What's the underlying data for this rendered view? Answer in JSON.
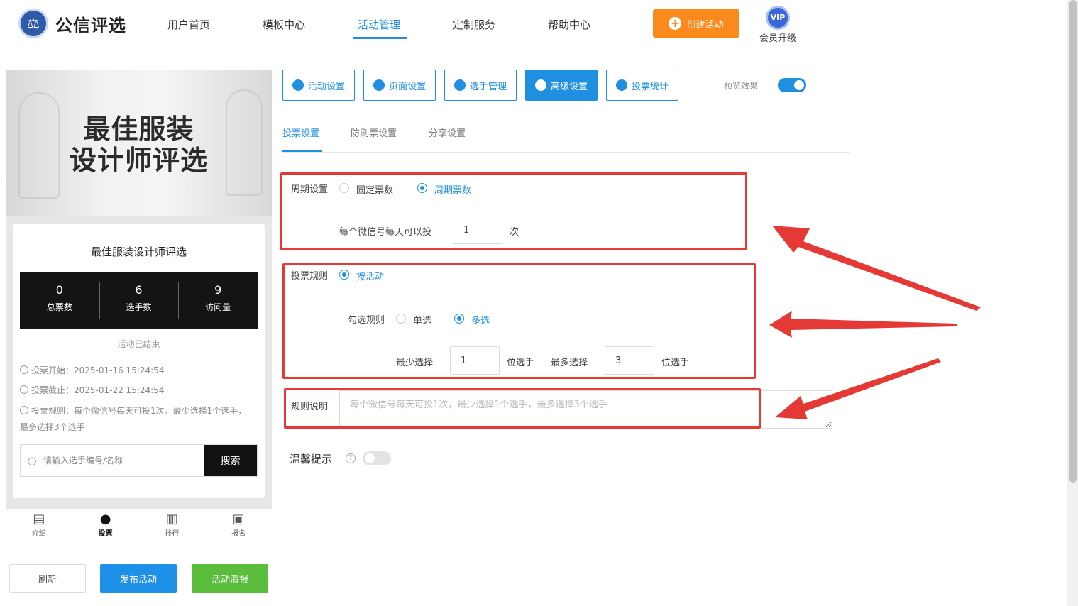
{
  "header": {
    "logo_text": "公信评选",
    "nav": [
      "用户首页",
      "模板中心",
      "活动管理",
      "定制服务",
      "帮助中心"
    ],
    "active_nav": "活动管理",
    "create_label": "创建活动",
    "vip_badge": "VIP",
    "vip_label": "会员升级"
  },
  "preview": {
    "banner_line1": "最佳服装",
    "banner_line2": "设计师评选",
    "activity_title": "最佳服装设计师评选",
    "stats": [
      {
        "value": "0",
        "label": "总票数"
      },
      {
        "value": "6",
        "label": "选手数"
      },
      {
        "value": "9",
        "label": "访问量"
      }
    ],
    "status": "活动已结束",
    "start": "投票开始：2025-01-16 15:24:54",
    "end": "投票截止：2025-01-22 15:24:54",
    "rule": "投票规则：每个微信号每天可投1次，最少选择1个选手，最多选择3个选手",
    "search_placeholder": "请输入选手编号/名称",
    "search_button": "搜索",
    "tabs": [
      "介绍",
      "投票",
      "排行",
      "报名"
    ],
    "active_tab": "投票"
  },
  "bottom_buttons": {
    "refresh": "刷新",
    "publish": "发布活动",
    "poster": "活动海报"
  },
  "settings": {
    "top_tabs": [
      "活动设置",
      "页面设置",
      "选手管理",
      "高级设置",
      "投票统计"
    ],
    "active_top_tab": "高级设置",
    "preview_label": "预览效果",
    "preview_on": true,
    "sub_tabs": [
      "投票设置",
      "防刷票设置",
      "分享设置"
    ],
    "active_sub_tab": "投票设置",
    "cycle": {
      "label": "周期设置",
      "option_fixed": "固定票数",
      "option_cycle": "周期票数",
      "selected": "周期票数",
      "per_day_label": "每个微信号每天可以投",
      "per_day_value": "1",
      "unit": "次"
    },
    "vote_rule": {
      "label": "投票规则",
      "option": "按活动",
      "check_label": "勾选规则",
      "single": "单选",
      "multi": "多选",
      "selected": "多选",
      "min_label": "最少选择",
      "min_value": "1",
      "min_unit": "位选手",
      "max_label": "最多选择",
      "max_value": "3",
      "max_unit": "位选手"
    },
    "rule_desc": {
      "label": "规则说明",
      "placeholder": "每个微信号每天可投1次，最少选择1个选手，最多选择3个选手"
    },
    "warm_tip": {
      "label": "温馨提示",
      "help": "?",
      "on": false
    }
  },
  "colors": {
    "primary": "#1e8fe1",
    "orange": "#f98a1b",
    "green": "#5bbd3c",
    "highlight": "#e53935"
  }
}
